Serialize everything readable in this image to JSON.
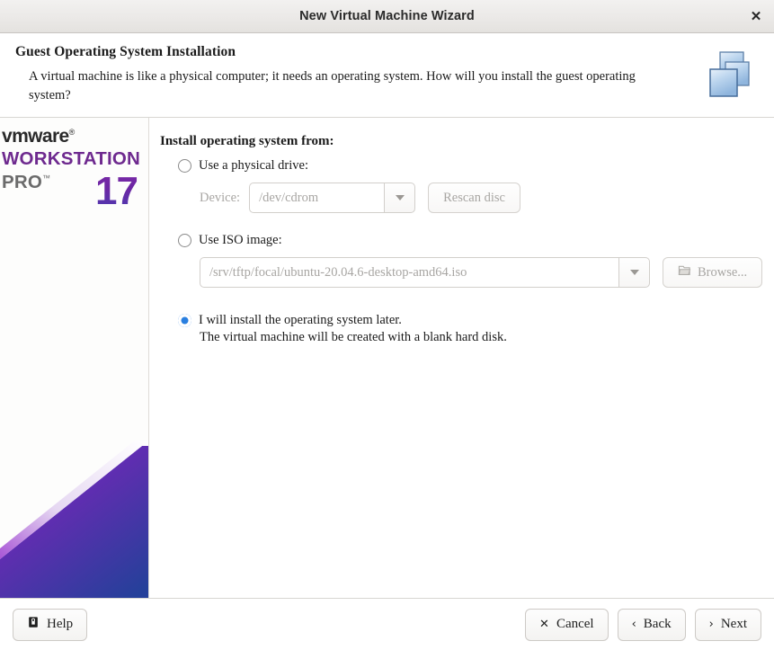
{
  "window": {
    "title": "New Virtual Machine Wizard",
    "close_label": "✕"
  },
  "header": {
    "title": "Guest Operating System Installation",
    "description": "A virtual machine is like a physical computer; it needs an operating system. How will you install the guest operating system?",
    "icon": "stacked-windows-icon"
  },
  "sidebar": {
    "brand": "vmware",
    "brand_mark": "®",
    "product": "WORKSTATION",
    "edition": "PRO",
    "edition_mark": "™",
    "version": "17",
    "brand_color": "#6e2a8f",
    "accent_color": "#2a7fe0",
    "art": {
      "purple": "#6b21a8",
      "blue": "#2b3f9e",
      "highlight": "#ffffff"
    }
  },
  "main": {
    "section_label": "Install operating system from:",
    "options": [
      {
        "id": "physical-drive",
        "label": "Use a physical drive:",
        "selected": false,
        "field_label": "Device:",
        "field_value": "/dev/cdrom",
        "button_label": "Rescan disc",
        "disabled": true
      },
      {
        "id": "iso-image",
        "label": "Use ISO image:",
        "selected": false,
        "field_value": "/srv/tftp/focal/ubuntu-20.04.6-desktop-amd64.iso",
        "button_label": "Browse...",
        "button_icon": "folder-open-icon",
        "disabled": true
      },
      {
        "id": "install-later",
        "label": "I will install the operating system later.",
        "sublabel": "The virtual machine will be created with a blank hard disk.",
        "selected": true,
        "disabled": false
      }
    ]
  },
  "footer": {
    "help_label": "Help",
    "help_icon": "help-document-icon",
    "cancel_label": "Cancel",
    "cancel_glyph": "✕",
    "back_label": "Back",
    "back_glyph": "‹",
    "next_label": "Next",
    "next_glyph": "›"
  }
}
